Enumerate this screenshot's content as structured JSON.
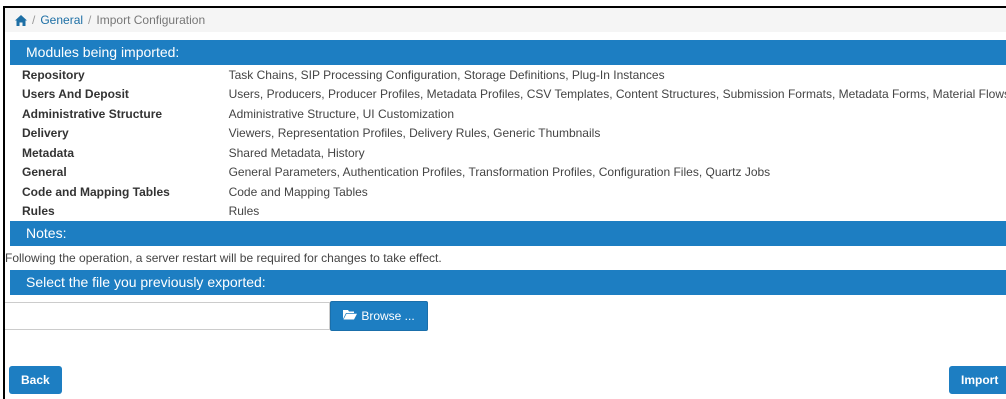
{
  "breadcrumb": {
    "home_icon": "home-icon",
    "general": "General",
    "current": "Import Configuration"
  },
  "sections": {
    "modules_title": "Modules being imported:",
    "notes_title": "Notes:",
    "file_title": "Select the file you previously exported:"
  },
  "modules": [
    {
      "name": "Repository",
      "items": "Task Chains, SIP Processing Configuration, Storage Definitions, Plug-In Instances"
    },
    {
      "name": "Users And Deposit",
      "items": "Users, Producers, Producer Profiles, Metadata Profiles, CSV Templates, Content Structures, Submission Formats, Metadata Forms, Material Flows"
    },
    {
      "name": "Administrative Structure",
      "items": "Administrative Structure, UI Customization"
    },
    {
      "name": "Delivery",
      "items": "Viewers, Representation Profiles, Delivery Rules, Generic Thumbnails"
    },
    {
      "name": "Metadata",
      "items": "Shared Metadata, History"
    },
    {
      "name": "General",
      "items": "General Parameters, Authentication Profiles, Transformation Profiles, Configuration Files, Quartz Jobs"
    },
    {
      "name": "Code and Mapping Tables",
      "items": "Code and Mapping Tables"
    },
    {
      "name": "Rules",
      "items": "Rules"
    }
  ],
  "notes": {
    "text": "Following the operation, a server restart will be required for changes to take effect."
  },
  "file": {
    "value": "",
    "browse_label": "Browse ...",
    "browse_icon": "folder-open-icon"
  },
  "buttons": {
    "back": "Back",
    "import": "Import"
  },
  "colors": {
    "accent": "#1d7ec2",
    "link": "#1d6fa5"
  }
}
